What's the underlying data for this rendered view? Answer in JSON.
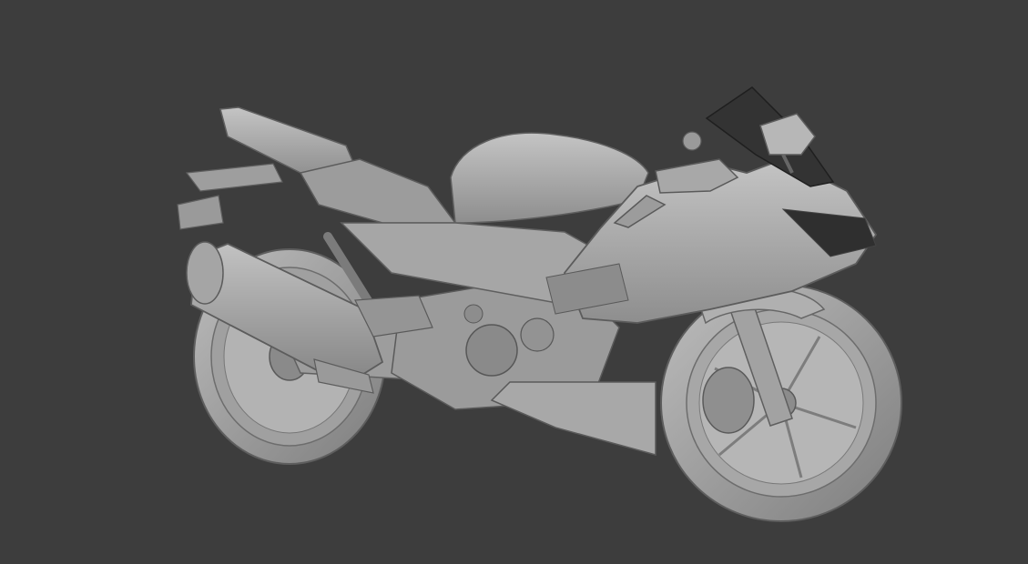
{
  "viewport": {
    "background": "#3d3d3d",
    "model": {
      "subject": "sport-motorcycle",
      "shading": "solid-clay",
      "base_color": "#a9a9a9",
      "dark_color": "#2f2f2f"
    }
  }
}
